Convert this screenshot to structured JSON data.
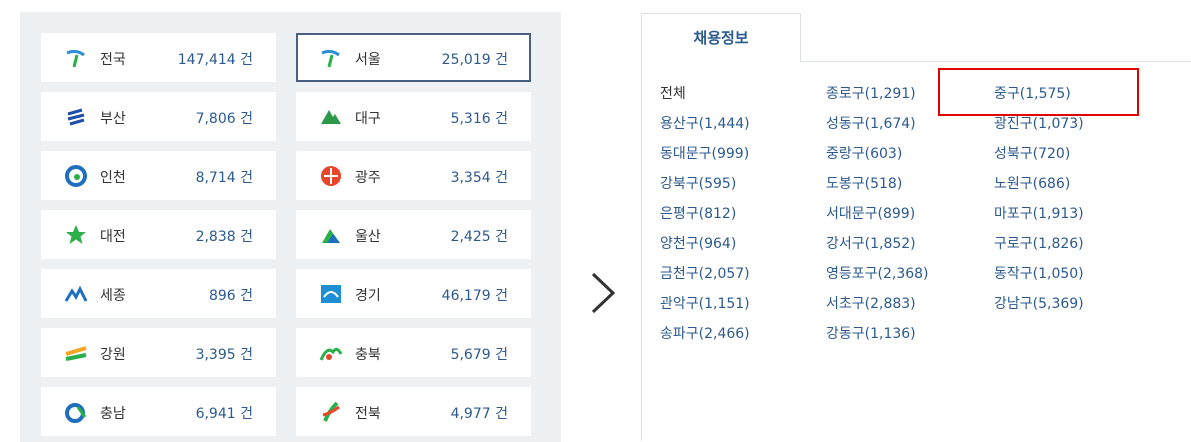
{
  "regions": [
    {
      "name": "전국",
      "count": "147,414 건",
      "icon": "nationwide-icon"
    },
    {
      "name": "서울",
      "count": "25,019 건",
      "icon": "seoul-icon",
      "selected": true
    },
    {
      "name": "부산",
      "count": "7,806 건",
      "icon": "busan-icon"
    },
    {
      "name": "대구",
      "count": "5,316 건",
      "icon": "daegu-icon"
    },
    {
      "name": "인천",
      "count": "8,714 건",
      "icon": "incheon-icon"
    },
    {
      "name": "광주",
      "count": "3,354 건",
      "icon": "gwangju-icon"
    },
    {
      "name": "대전",
      "count": "2,838 건",
      "icon": "daejeon-icon"
    },
    {
      "name": "울산",
      "count": "2,425 건",
      "icon": "ulsan-icon"
    },
    {
      "name": "세종",
      "count": "896 건",
      "icon": "sejong-icon"
    },
    {
      "name": "경기",
      "count": "46,179 건",
      "icon": "gyeonggi-icon"
    },
    {
      "name": "강원",
      "count": "3,395 건",
      "icon": "gangwon-icon"
    },
    {
      "name": "충북",
      "count": "5,679 건",
      "icon": "chungbuk-icon"
    },
    {
      "name": "충남",
      "count": "6,941 건",
      "icon": "chungnam-icon"
    },
    {
      "name": "전북",
      "count": "4,977 건",
      "icon": "jeonbuk-icon"
    }
  ],
  "tab": {
    "label": "채용정보"
  },
  "districts": [
    "전체",
    "종로구(1,291)",
    "중구(1,575)",
    "용산구(1,444)",
    "성동구(1,674)",
    "광진구(1,073)",
    "동대문구(999)",
    "중랑구(603)",
    "성북구(720)",
    "강북구(595)",
    "도봉구(518)",
    "노원구(686)",
    "은평구(812)",
    "서대문구(899)",
    "마포구(1,913)",
    "양천구(964)",
    "강서구(1,852)",
    "구로구(1,826)",
    "금천구(2,057)",
    "영등포구(2,368)",
    "동작구(1,050)",
    "관악구(1,151)",
    "서초구(2,883)",
    "강남구(5,369)",
    "송파구(2,466)",
    "강동구(1,136)"
  ],
  "colors": {
    "accent": "#2c5a8f",
    "highlight": "#e10000",
    "panel_bg": "#eef1f4"
  },
  "icons": {
    "arrow": "chevron-right-icon"
  }
}
